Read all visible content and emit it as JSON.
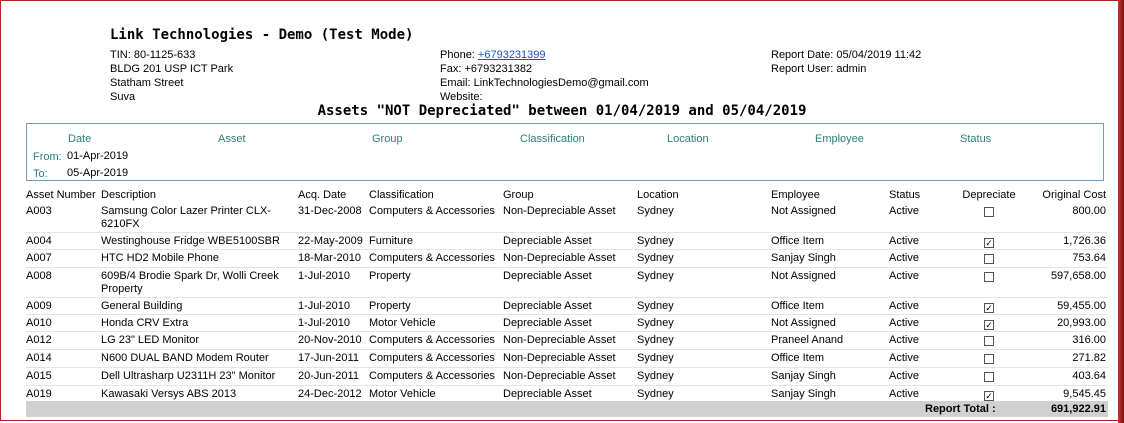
{
  "company": {
    "name": "Link Technologies - Demo (Test Mode)",
    "tin": "TIN: 80-1125-633",
    "address1": "BLDG 201 USP ICT Park",
    "address2": "Statham Street",
    "address3": "Suva",
    "phone_label": "Phone: ",
    "phone": "+6793231399",
    "fax": "Fax: +6793231382",
    "email": "Email: LinkTechnologiesDemo@gmail.com",
    "website": "Website:",
    "report_date": "Report Date: 05/04/2019 11:42",
    "report_user": "Report User: admin"
  },
  "report_title": "Assets \"NOT Depreciated\" between 01/04/2019 and 05/04/2019",
  "filter": {
    "headers": [
      "Date",
      "Asset",
      "Group",
      "Classification",
      "Location",
      "Employee",
      "Status"
    ],
    "from_label": "From:",
    "from_value": "01-Apr-2019",
    "to_label": "To:",
    "to_value": "05-Apr-2019"
  },
  "table": {
    "columns": [
      "Asset Number",
      "Description",
      "Acq. Date",
      "Classification",
      "Group",
      "Location",
      "Employee",
      "Status",
      "Depreciate",
      "Original Cost"
    ],
    "rows": [
      {
        "num": "A003",
        "desc": "Samsung Color Lazer Printer CLX-6210FX",
        "date": "31-Dec-2008",
        "cls": "Computers & Accessories",
        "group": "Non-Depreciable Asset",
        "loc": "Sydney",
        "emp": "Not Assigned",
        "status": "Active",
        "dep": false,
        "cost": "800.00"
      },
      {
        "num": "A004",
        "desc": "Westinghouse Fridge WBE5100SBR",
        "date": "22-May-2009",
        "cls": "Furniture",
        "group": "Depreciable Asset",
        "loc": "Sydney",
        "emp": "Office Item",
        "status": "Active",
        "dep": true,
        "cost": "1,726.36"
      },
      {
        "num": "A007",
        "desc": "HTC HD2 Mobile Phone",
        "date": "18-Mar-2010",
        "cls": "Computers & Accessories",
        "group": "Non-Depreciable Asset",
        "loc": "Sydney",
        "emp": "Sanjay Singh",
        "status": "Active",
        "dep": false,
        "cost": "753.64"
      },
      {
        "num": "A008",
        "desc": "609B/4 Brodie Spark Dr, Wolli Creek Property",
        "date": "1-Jul-2010",
        "cls": "Property",
        "group": "Depreciable Asset",
        "loc": "Sydney",
        "emp": "Not Assigned",
        "status": "Active",
        "dep": false,
        "cost": "597,658.00"
      },
      {
        "num": "A009",
        "desc": "General Building",
        "date": "1-Jul-2010",
        "cls": "Property",
        "group": "Depreciable Asset",
        "loc": "Sydney",
        "emp": "Office Item",
        "status": "Active",
        "dep": true,
        "cost": "59,455.00"
      },
      {
        "num": "A010",
        "desc": "Honda CRV Extra",
        "date": "1-Jul-2010",
        "cls": "Motor Vehicle",
        "group": "Depreciable Asset",
        "loc": "Sydney",
        "emp": "Not Assigned",
        "status": "Active",
        "dep": true,
        "cost": "20,993.00"
      },
      {
        "num": "A012",
        "desc": "LG 23\" LED Monitor",
        "date": "20-Nov-2010",
        "cls": "Computers & Accessories",
        "group": "Non-Depreciable Asset",
        "loc": "Sydney",
        "emp": "Praneel Anand",
        "status": "Active",
        "dep": false,
        "cost": "316.00"
      },
      {
        "num": "A014",
        "desc": "N600 DUAL BAND Modem Router",
        "date": "17-Jun-2011",
        "cls": "Computers & Accessories",
        "group": "Non-Depreciable Asset",
        "loc": "Sydney",
        "emp": "Office Item",
        "status": "Active",
        "dep": false,
        "cost": "271.82"
      },
      {
        "num": "A015",
        "desc": "Dell Ultrasharp U2311H 23\" Monitor",
        "date": "20-Jun-2011",
        "cls": "Computers & Accessories",
        "group": "Non-Depreciable Asset",
        "loc": "Sydney",
        "emp": "Sanjay Singh",
        "status": "Active",
        "dep": false,
        "cost": "403.64"
      },
      {
        "num": "A019",
        "desc": "Kawasaki Versys ABS 2013",
        "date": "24-Dec-2012",
        "cls": "Motor Vehicle",
        "group": "Depreciable Asset",
        "loc": "Sydney",
        "emp": "Sanjay Singh",
        "status": "Active",
        "dep": true,
        "cost": "9,545.45"
      }
    ]
  },
  "total": {
    "label": "Report Total :",
    "value": "691,922.91"
  }
}
